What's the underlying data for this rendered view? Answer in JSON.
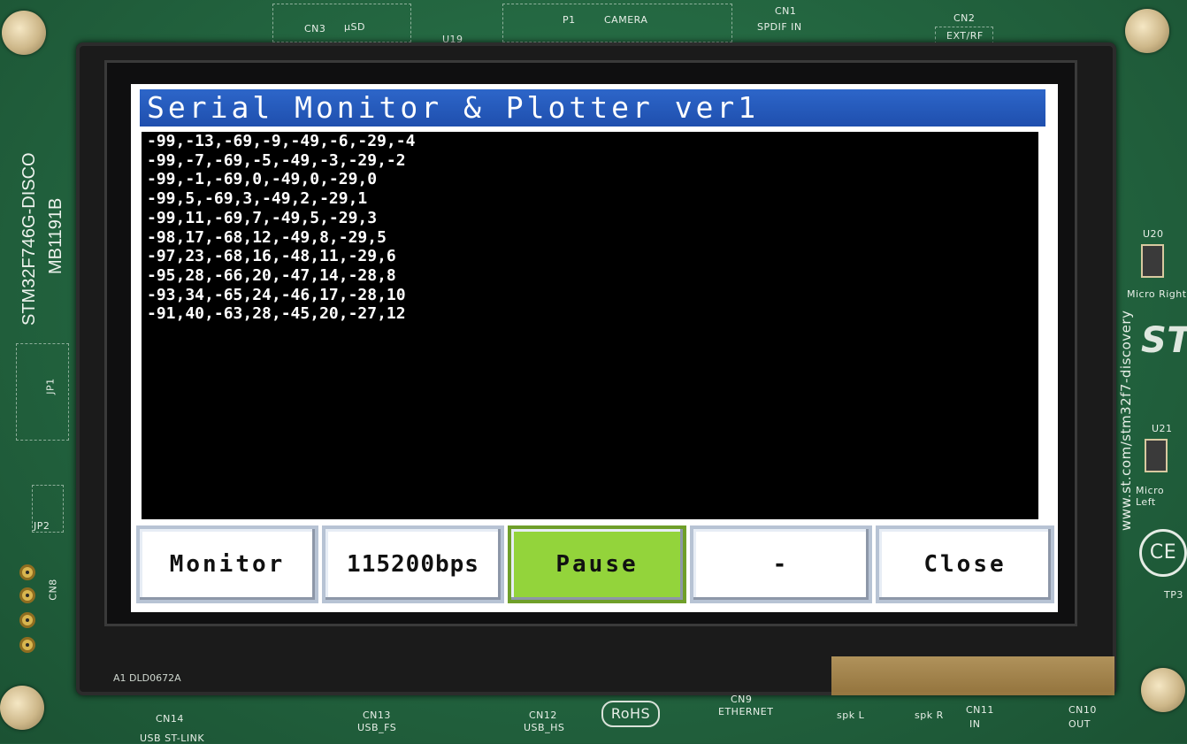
{
  "board": {
    "top_labels": {
      "cn3": "CN3",
      "usd": "µSD",
      "u19": "U19",
      "p1": "P1",
      "camera": "CAMERA",
      "cn1": "CN1",
      "spdif": "SPDIF  IN",
      "cn2": "CN2",
      "extrf": "EXT/RF"
    },
    "left_labels": {
      "board_name": "STM32F746G-DISCO",
      "board_id": "MB1191B",
      "jp1": "JP1",
      "jp2": "JP2",
      "cn8": "CN8"
    },
    "right_labels": {
      "u20": "U20",
      "micro_right": "Micro Right",
      "u21": "U21",
      "micro_left": "Micro Left",
      "url": "www.st.com/stm32f7-discovery",
      "tp3": "TP3"
    },
    "bottom_labels": {
      "lcd_code": "A1 DLD0672A",
      "cn14": "CN14",
      "usb_st_link": "USB ST-LINK",
      "cn13": "CN13",
      "usb_fs": "USB_FS",
      "cn12": "CN12",
      "usb_hs": "USB_HS",
      "rohs": "RoHS",
      "cn9": "CN9",
      "ethernet": "ETHERNET",
      "spk_l": "spk L",
      "spk_r": "spk R",
      "cn11": "CN11",
      "cn11_in": "IN",
      "cn10": "CN10",
      "cn10_out": "OUT"
    }
  },
  "app": {
    "title": "Serial Monitor & Plotter ver1",
    "lines": [
      "-99,-13,-69,-9,-49,-6,-29,-4",
      "-99,-7,-69,-5,-49,-3,-29,-2",
      "-99,-1,-69,0,-49,0,-29,0",
      "-99,5,-69,3,-49,2,-29,1",
      "-99,11,-69,7,-49,5,-29,3",
      "-98,17,-68,12,-49,8,-29,5",
      "-97,23,-68,16,-48,11,-29,6",
      "-95,28,-66,20,-47,14,-28,8",
      "-93,34,-65,24,-46,17,-28,10",
      "-91,40,-63,28,-45,20,-27,12"
    ],
    "buttons": {
      "mode": "Monitor",
      "baud": "115200bps",
      "pause": "Pause",
      "extra": "-",
      "close": "Close"
    },
    "colors": {
      "title_bar": "#2d66c9",
      "pause_active": "#93d43b",
      "terminal_bg": "#000000",
      "terminal_text": "#ffffff"
    }
  }
}
